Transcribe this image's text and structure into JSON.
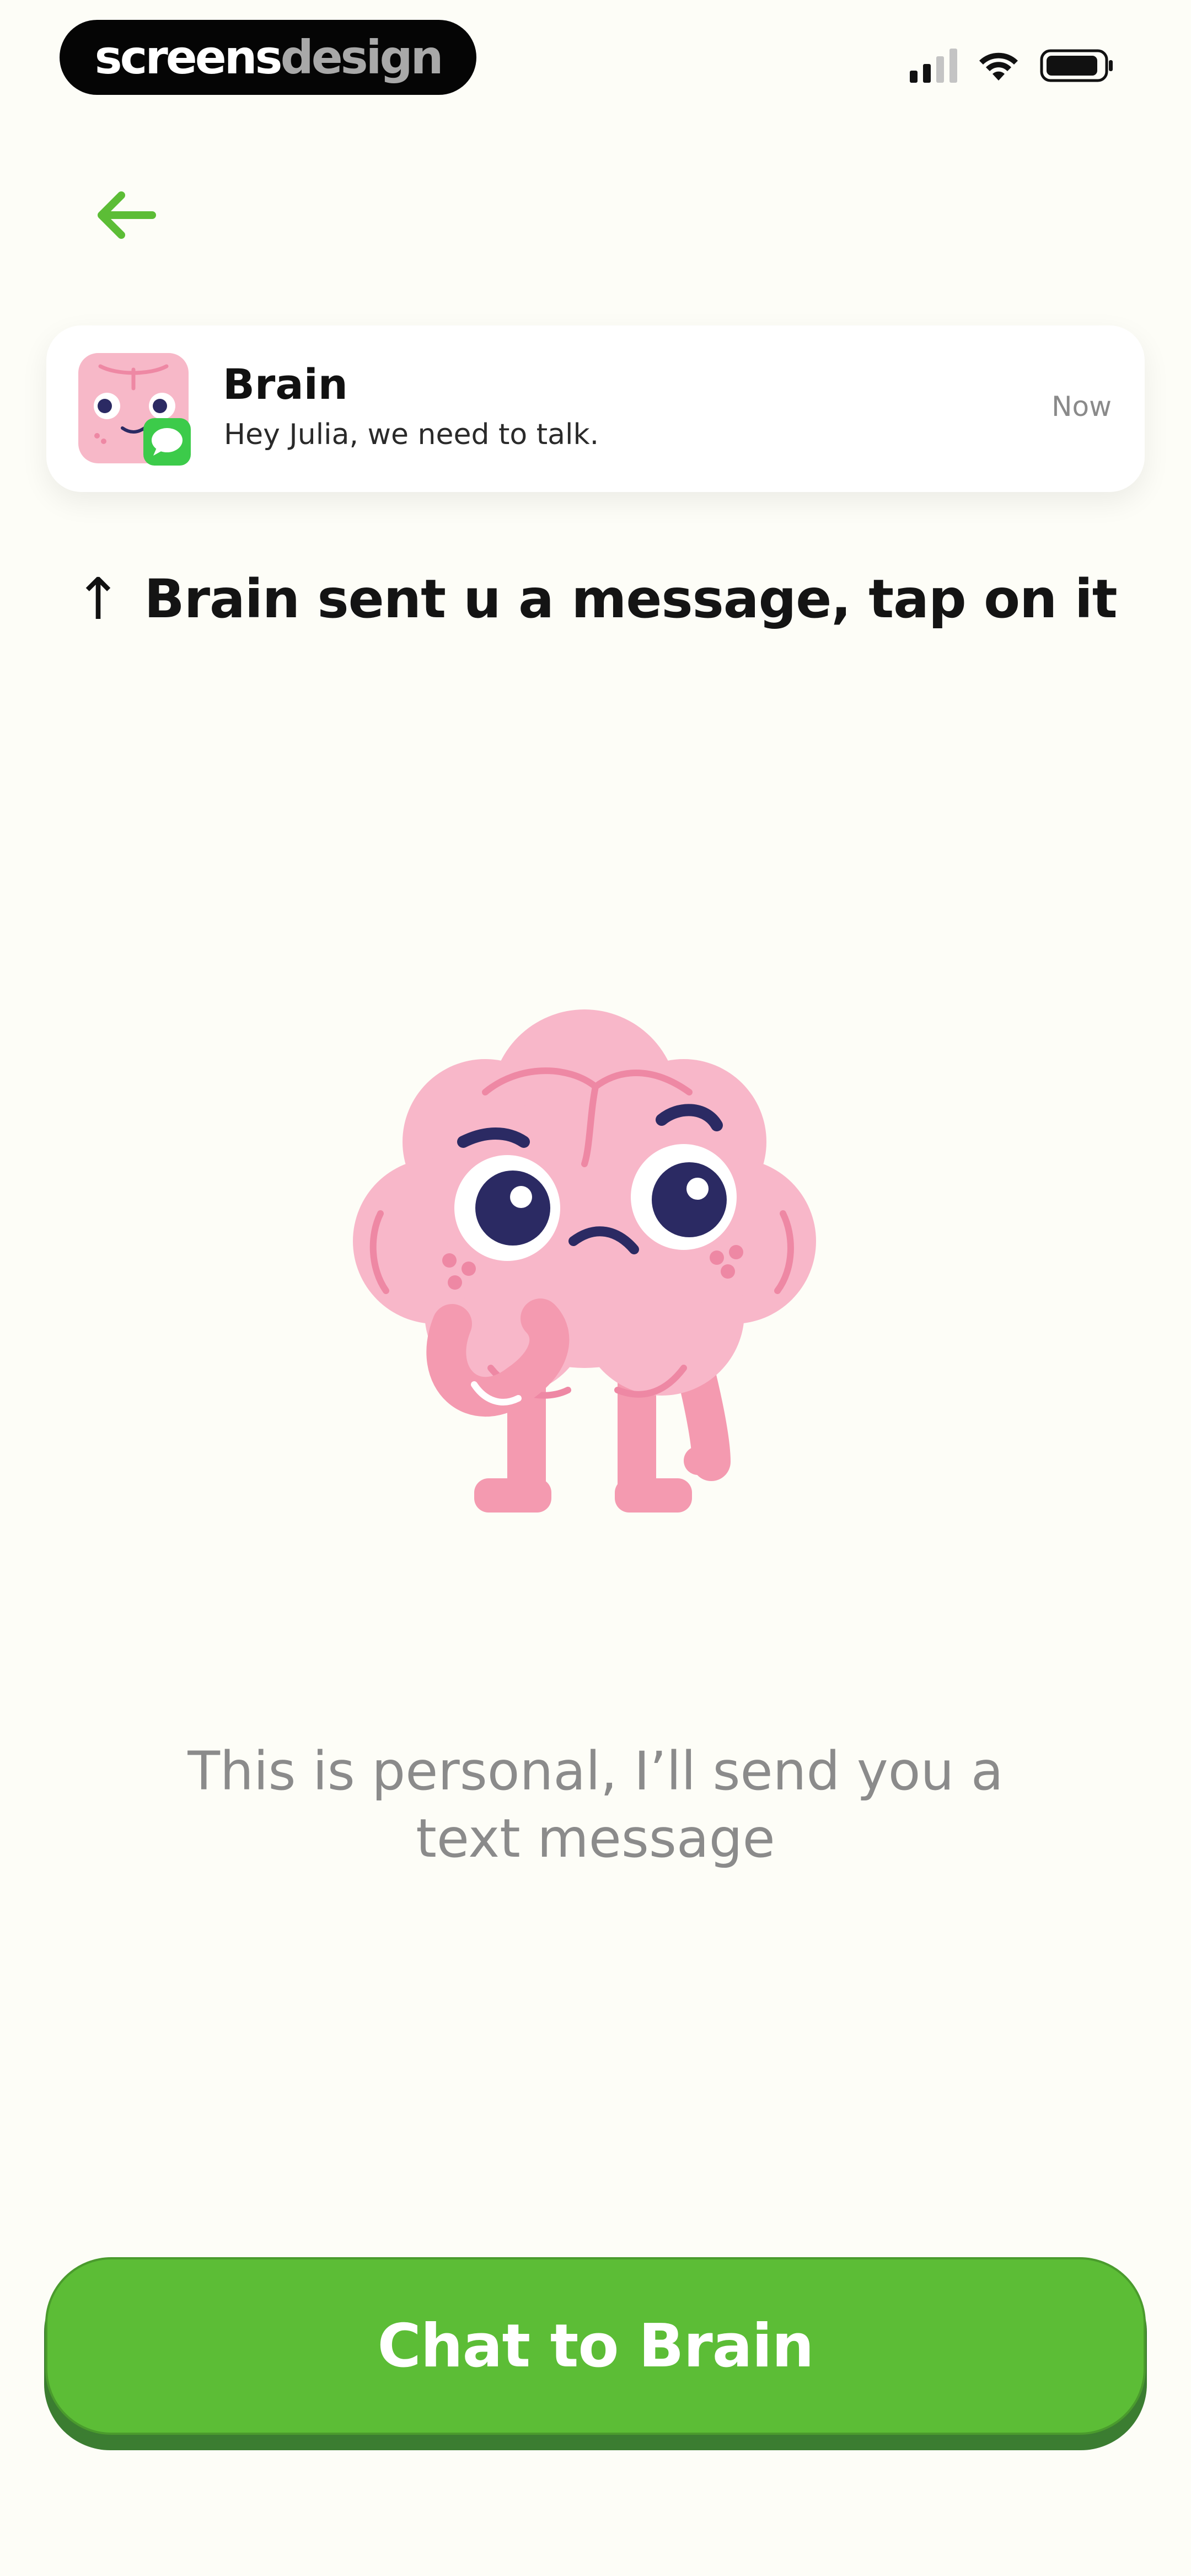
{
  "status_bar": {
    "brand_part1": "screens",
    "brand_part2": "design",
    "icons": [
      "cellular-signal-icon",
      "wifi-icon",
      "battery-icon"
    ]
  },
  "nav": {
    "back_icon": "arrow-left-icon",
    "accent_color": "#5cbd36"
  },
  "notification": {
    "title": "Brain",
    "body": "Hey Julia, we need to talk.",
    "time": "Now",
    "app_icon": "messages-icon",
    "avatar": "brain-avatar"
  },
  "instruction": {
    "arrow": "↑",
    "text": "Brain sent u a message, tap on it"
  },
  "caption": {
    "line1": "This is personal, I’ll send you a",
    "line2": "text message"
  },
  "cta": {
    "label": "Chat to Brain",
    "color": "#5cbd36"
  }
}
